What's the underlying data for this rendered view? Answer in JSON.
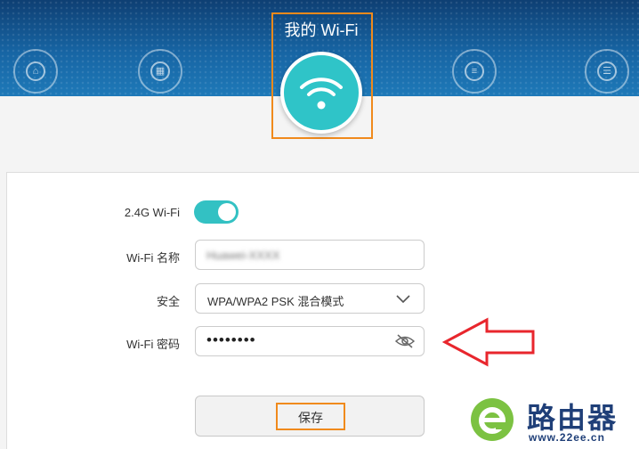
{
  "header": {
    "nav_items": [
      {
        "label": "",
        "icon": "home-icon",
        "glyph": "⌂"
      },
      {
        "label": "",
        "icon": "devices-icon",
        "glyph": "▦"
      },
      {
        "label": "",
        "icon": "tools-icon",
        "glyph": "≡"
      },
      {
        "label": "",
        "icon": "more-icon",
        "glyph": "☰"
      }
    ],
    "active_item": {
      "title": "我的 Wi-Fi",
      "icon": "wifi-icon"
    }
  },
  "form": {
    "wifi_24g": {
      "label": "2.4G Wi-Fi",
      "enabled": true
    },
    "ssid": {
      "label": "Wi-Fi 名称",
      "value": "Huawei-XXXX"
    },
    "security": {
      "label": "安全",
      "value": "WPA/WPA2 PSK 混合模式"
    },
    "password": {
      "label": "Wi-Fi 密码",
      "masked": "••••••••",
      "icon": "eye-hidden-icon"
    },
    "save_label": "保存"
  },
  "annotation": {
    "arrow_color": "#e8262d",
    "highlight_color": "#f08a1c"
  },
  "watermark": {
    "brand": "路由器",
    "url": "www.22ee.cn"
  },
  "colors": {
    "accent": "#33c1c3",
    "banner": "#1765a4"
  }
}
